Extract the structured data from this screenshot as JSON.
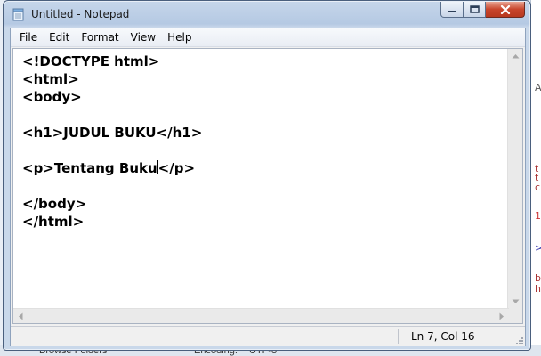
{
  "window": {
    "title": "Untitled - Notepad"
  },
  "menu": {
    "items": [
      {
        "label": "File"
      },
      {
        "label": "Edit"
      },
      {
        "label": "Format"
      },
      {
        "label": "View"
      },
      {
        "label": "Help"
      }
    ]
  },
  "editor": {
    "lines": [
      "<!DOCTYPE html>",
      "<html>",
      "<body>",
      "",
      "<h1>JUDUL BUKU</h1>",
      "",
      "<p>Tentang Buku",
      "",
      "</body>",
      "</html>"
    ],
    "line7_after_caret": "</p>"
  },
  "status": {
    "position": "Ln 7, Col 16"
  },
  "background": {
    "bottom_left": "Browse Folders",
    "bottom_mid_label": "Encoding:",
    "bottom_mid_value": "UTF-8",
    "right_marks": [
      "A",
      "t",
      "t",
      "c",
      "1",
      ">",
      "b",
      "h"
    ]
  },
  "colors": {
    "window_frame": "#c9d8ea",
    "close_button": "#c8452c",
    "editor_bg": "#ffffff"
  },
  "icons": [
    "notepad-app-icon",
    "minimize-icon",
    "maximize-icon",
    "close-icon",
    "scroll-up-icon",
    "scroll-down-icon",
    "scroll-left-icon",
    "scroll-right-icon",
    "size-grip-icon"
  ]
}
